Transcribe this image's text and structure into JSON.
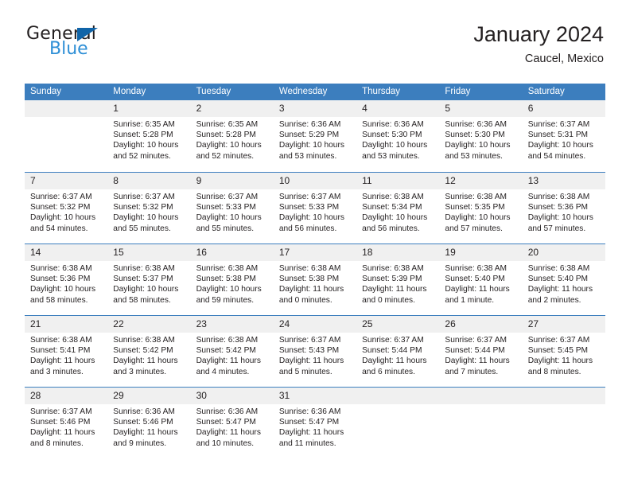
{
  "brand": {
    "name_top": "General",
    "name_bottom": "Blue",
    "triangle_color": "#1064a8",
    "blue_color": "#2e8fd6"
  },
  "header": {
    "title": "January 2024",
    "subtitle": "Caucel, Mexico",
    "header_bg": "#3c7ebe",
    "daynum_bg": "#f0f0f0"
  },
  "weekdays": [
    "Sunday",
    "Monday",
    "Tuesday",
    "Wednesday",
    "Thursday",
    "Friday",
    "Saturday"
  ],
  "labels": {
    "sunrise_prefix": "Sunrise:",
    "sunset_prefix": "Sunset:",
    "daylight_prefix": "Daylight:"
  },
  "weeks": [
    [
      {
        "day": "",
        "sunrise": "",
        "sunset": "",
        "daylight_line1": "",
        "daylight_line2": ""
      },
      {
        "day": "1",
        "sunrise": "Sunrise: 6:35 AM",
        "sunset": "Sunset: 5:28 PM",
        "daylight_line1": "Daylight: 10 hours",
        "daylight_line2": "and 52 minutes."
      },
      {
        "day": "2",
        "sunrise": "Sunrise: 6:35 AM",
        "sunset": "Sunset: 5:28 PM",
        "daylight_line1": "Daylight: 10 hours",
        "daylight_line2": "and 52 minutes."
      },
      {
        "day": "3",
        "sunrise": "Sunrise: 6:36 AM",
        "sunset": "Sunset: 5:29 PM",
        "daylight_line1": "Daylight: 10 hours",
        "daylight_line2": "and 53 minutes."
      },
      {
        "day": "4",
        "sunrise": "Sunrise: 6:36 AM",
        "sunset": "Sunset: 5:30 PM",
        "daylight_line1": "Daylight: 10 hours",
        "daylight_line2": "and 53 minutes."
      },
      {
        "day": "5",
        "sunrise": "Sunrise: 6:36 AM",
        "sunset": "Sunset: 5:30 PM",
        "daylight_line1": "Daylight: 10 hours",
        "daylight_line2": "and 53 minutes."
      },
      {
        "day": "6",
        "sunrise": "Sunrise: 6:37 AM",
        "sunset": "Sunset: 5:31 PM",
        "daylight_line1": "Daylight: 10 hours",
        "daylight_line2": "and 54 minutes."
      }
    ],
    [
      {
        "day": "7",
        "sunrise": "Sunrise: 6:37 AM",
        "sunset": "Sunset: 5:32 PM",
        "daylight_line1": "Daylight: 10 hours",
        "daylight_line2": "and 54 minutes."
      },
      {
        "day": "8",
        "sunrise": "Sunrise: 6:37 AM",
        "sunset": "Sunset: 5:32 PM",
        "daylight_line1": "Daylight: 10 hours",
        "daylight_line2": "and 55 minutes."
      },
      {
        "day": "9",
        "sunrise": "Sunrise: 6:37 AM",
        "sunset": "Sunset: 5:33 PM",
        "daylight_line1": "Daylight: 10 hours",
        "daylight_line2": "and 55 minutes."
      },
      {
        "day": "10",
        "sunrise": "Sunrise: 6:37 AM",
        "sunset": "Sunset: 5:33 PM",
        "daylight_line1": "Daylight: 10 hours",
        "daylight_line2": "and 56 minutes."
      },
      {
        "day": "11",
        "sunrise": "Sunrise: 6:38 AM",
        "sunset": "Sunset: 5:34 PM",
        "daylight_line1": "Daylight: 10 hours",
        "daylight_line2": "and 56 minutes."
      },
      {
        "day": "12",
        "sunrise": "Sunrise: 6:38 AM",
        "sunset": "Sunset: 5:35 PM",
        "daylight_line1": "Daylight: 10 hours",
        "daylight_line2": "and 57 minutes."
      },
      {
        "day": "13",
        "sunrise": "Sunrise: 6:38 AM",
        "sunset": "Sunset: 5:36 PM",
        "daylight_line1": "Daylight: 10 hours",
        "daylight_line2": "and 57 minutes."
      }
    ],
    [
      {
        "day": "14",
        "sunrise": "Sunrise: 6:38 AM",
        "sunset": "Sunset: 5:36 PM",
        "daylight_line1": "Daylight: 10 hours",
        "daylight_line2": "and 58 minutes."
      },
      {
        "day": "15",
        "sunrise": "Sunrise: 6:38 AM",
        "sunset": "Sunset: 5:37 PM",
        "daylight_line1": "Daylight: 10 hours",
        "daylight_line2": "and 58 minutes."
      },
      {
        "day": "16",
        "sunrise": "Sunrise: 6:38 AM",
        "sunset": "Sunset: 5:38 PM",
        "daylight_line1": "Daylight: 10 hours",
        "daylight_line2": "and 59 minutes."
      },
      {
        "day": "17",
        "sunrise": "Sunrise: 6:38 AM",
        "sunset": "Sunset: 5:38 PM",
        "daylight_line1": "Daylight: 11 hours",
        "daylight_line2": "and 0 minutes."
      },
      {
        "day": "18",
        "sunrise": "Sunrise: 6:38 AM",
        "sunset": "Sunset: 5:39 PM",
        "daylight_line1": "Daylight: 11 hours",
        "daylight_line2": "and 0 minutes."
      },
      {
        "day": "19",
        "sunrise": "Sunrise: 6:38 AM",
        "sunset": "Sunset: 5:40 PM",
        "daylight_line1": "Daylight: 11 hours",
        "daylight_line2": "and 1 minute."
      },
      {
        "day": "20",
        "sunrise": "Sunrise: 6:38 AM",
        "sunset": "Sunset: 5:40 PM",
        "daylight_line1": "Daylight: 11 hours",
        "daylight_line2": "and 2 minutes."
      }
    ],
    [
      {
        "day": "21",
        "sunrise": "Sunrise: 6:38 AM",
        "sunset": "Sunset: 5:41 PM",
        "daylight_line1": "Daylight: 11 hours",
        "daylight_line2": "and 3 minutes."
      },
      {
        "day": "22",
        "sunrise": "Sunrise: 6:38 AM",
        "sunset": "Sunset: 5:42 PM",
        "daylight_line1": "Daylight: 11 hours",
        "daylight_line2": "and 3 minutes."
      },
      {
        "day": "23",
        "sunrise": "Sunrise: 6:38 AM",
        "sunset": "Sunset: 5:42 PM",
        "daylight_line1": "Daylight: 11 hours",
        "daylight_line2": "and 4 minutes."
      },
      {
        "day": "24",
        "sunrise": "Sunrise: 6:37 AM",
        "sunset": "Sunset: 5:43 PM",
        "daylight_line1": "Daylight: 11 hours",
        "daylight_line2": "and 5 minutes."
      },
      {
        "day": "25",
        "sunrise": "Sunrise: 6:37 AM",
        "sunset": "Sunset: 5:44 PM",
        "daylight_line1": "Daylight: 11 hours",
        "daylight_line2": "and 6 minutes."
      },
      {
        "day": "26",
        "sunrise": "Sunrise: 6:37 AM",
        "sunset": "Sunset: 5:44 PM",
        "daylight_line1": "Daylight: 11 hours",
        "daylight_line2": "and 7 minutes."
      },
      {
        "day": "27",
        "sunrise": "Sunrise: 6:37 AM",
        "sunset": "Sunset: 5:45 PM",
        "daylight_line1": "Daylight: 11 hours",
        "daylight_line2": "and 8 minutes."
      }
    ],
    [
      {
        "day": "28",
        "sunrise": "Sunrise: 6:37 AM",
        "sunset": "Sunset: 5:46 PM",
        "daylight_line1": "Daylight: 11 hours",
        "daylight_line2": "and 8 minutes."
      },
      {
        "day": "29",
        "sunrise": "Sunrise: 6:36 AM",
        "sunset": "Sunset: 5:46 PM",
        "daylight_line1": "Daylight: 11 hours",
        "daylight_line2": "and 9 minutes."
      },
      {
        "day": "30",
        "sunrise": "Sunrise: 6:36 AM",
        "sunset": "Sunset: 5:47 PM",
        "daylight_line1": "Daylight: 11 hours",
        "daylight_line2": "and 10 minutes."
      },
      {
        "day": "31",
        "sunrise": "Sunrise: 6:36 AM",
        "sunset": "Sunset: 5:47 PM",
        "daylight_line1": "Daylight: 11 hours",
        "daylight_line2": "and 11 minutes."
      },
      {
        "day": "",
        "sunrise": "",
        "sunset": "",
        "daylight_line1": "",
        "daylight_line2": ""
      },
      {
        "day": "",
        "sunrise": "",
        "sunset": "",
        "daylight_line1": "",
        "daylight_line2": ""
      },
      {
        "day": "",
        "sunrise": "",
        "sunset": "",
        "daylight_line1": "",
        "daylight_line2": ""
      }
    ]
  ]
}
